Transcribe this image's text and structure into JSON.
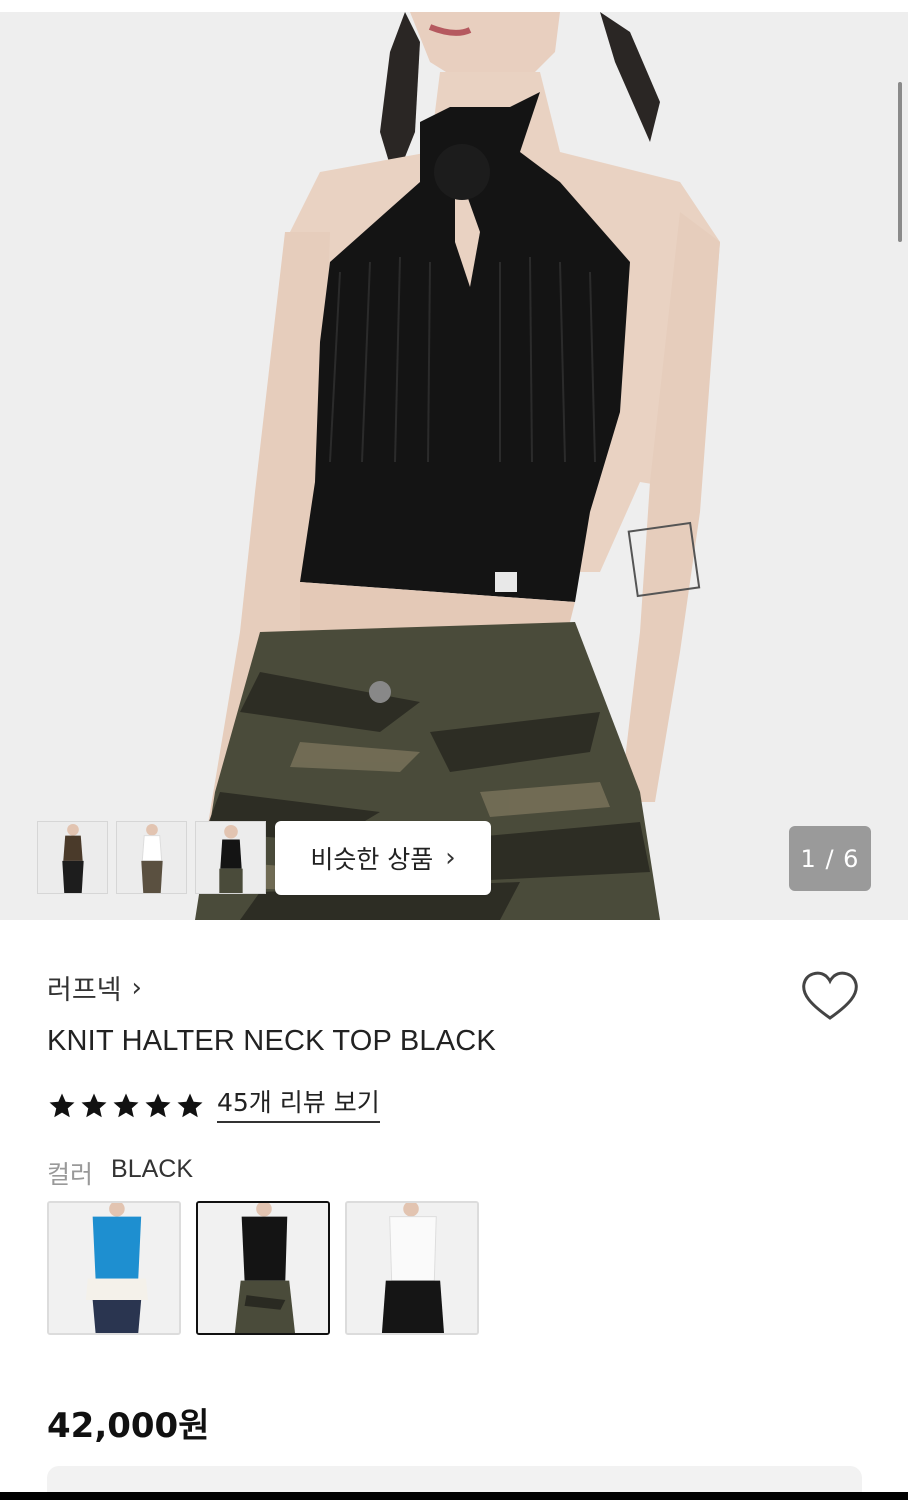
{
  "gallery": {
    "counter": "1 / 6",
    "similar_button_label": "비슷한 상품",
    "similar_button_icon": "chevron-right-icon",
    "thumbnails": [
      {
        "name": "brown-tank-model"
      },
      {
        "name": "white-tank-model"
      },
      {
        "name": "black-halter-model"
      }
    ]
  },
  "product": {
    "brand": "러프넥",
    "brand_icon": "chevron-right-icon",
    "title": "KNIT HALTER NECK TOP BLACK",
    "rating_stars": 5,
    "review_link": "45개 리뷰 보기",
    "color_label": "컬러",
    "color_value": "BLACK",
    "swatches": [
      {
        "name": "blue",
        "selected": false,
        "color": "#1e8fd0"
      },
      {
        "name": "black",
        "selected": true,
        "color": "#111111"
      },
      {
        "name": "white",
        "selected": false,
        "color": "#f7f7f7"
      }
    ],
    "price": "42,000원",
    "wishlist_icon": "heart-outline-icon"
  }
}
